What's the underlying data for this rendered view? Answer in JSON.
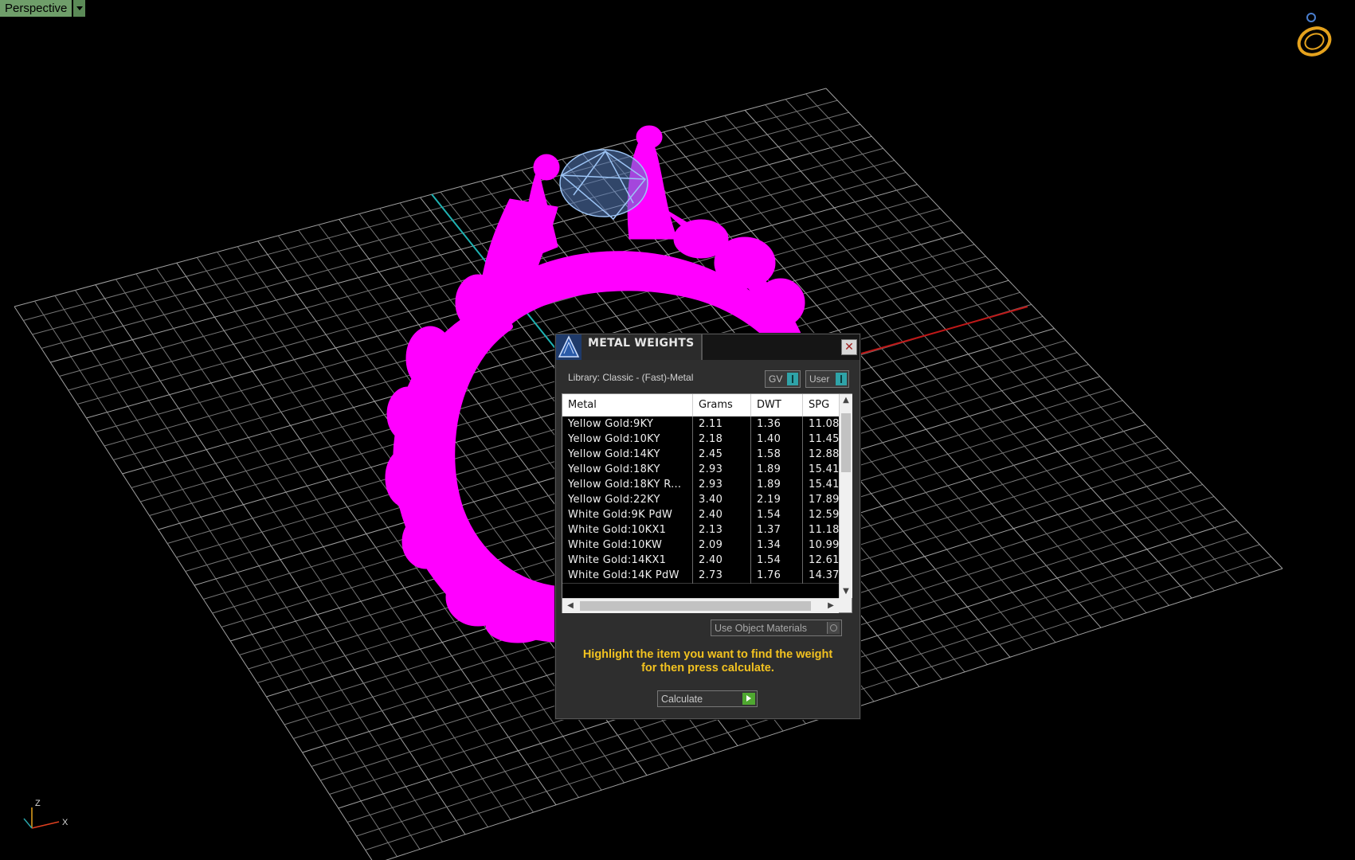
{
  "viewport": {
    "label": "Perspective",
    "axis_labels": {
      "z": "Z",
      "x": "X"
    }
  },
  "dialog": {
    "title": "METAL WEIGHTS",
    "close_glyph": "✕",
    "library_label": "Library: Classic - (Fast)-Metal",
    "toggle_gv": "GV",
    "toggle_user": "User",
    "columns": [
      "Metal",
      "Grams",
      "DWT",
      "SPG"
    ],
    "rows": [
      [
        "Yellow Gold:9KY",
        "2.11",
        "1.36",
        "11.08"
      ],
      [
        "Yellow Gold:10KY",
        "2.18",
        "1.40",
        "11.45"
      ],
      [
        "Yellow Gold:14KY",
        "2.45",
        "1.58",
        "12.88"
      ],
      [
        "Yellow Gold:18KY",
        "2.93",
        "1.89",
        "15.41"
      ],
      [
        "Yellow Gold:18KY R...",
        "2.93",
        "1.89",
        "15.41"
      ],
      [
        "Yellow Gold:22KY",
        "3.40",
        "2.19",
        "17.89"
      ],
      [
        "White Gold:9K PdW",
        "2.40",
        "1.54",
        "12.59"
      ],
      [
        "White Gold:10KX1",
        "2.13",
        "1.37",
        "11.18"
      ],
      [
        "White Gold:10KW",
        "2.09",
        "1.34",
        "10.99"
      ],
      [
        "White Gold:14KX1",
        "2.40",
        "1.54",
        "12.61"
      ],
      [
        "White Gold:14K PdW",
        "2.73",
        "1.76",
        "14.37"
      ]
    ],
    "use_object_materials": "Use Object Materials",
    "hint_line1": "Highlight the item you want to find the weight",
    "hint_line2": "for then press calculate.",
    "calculate_label": "Calculate"
  },
  "colors": {
    "ring": "#ff00ff",
    "gem": "#9cc4f5",
    "grid": "#8a8a8a",
    "axis_x": "#c01818",
    "axis_y": "#1fb3b3",
    "hint": "#f2c220",
    "viewport_label_bg": "#6f9e6a"
  },
  "icons": [
    "ring-icon",
    "dropdown-arrow-icon",
    "close-icon",
    "matrix-logo-icon",
    "axis-gizmo-icon",
    "calculate-arrow-icon"
  ]
}
